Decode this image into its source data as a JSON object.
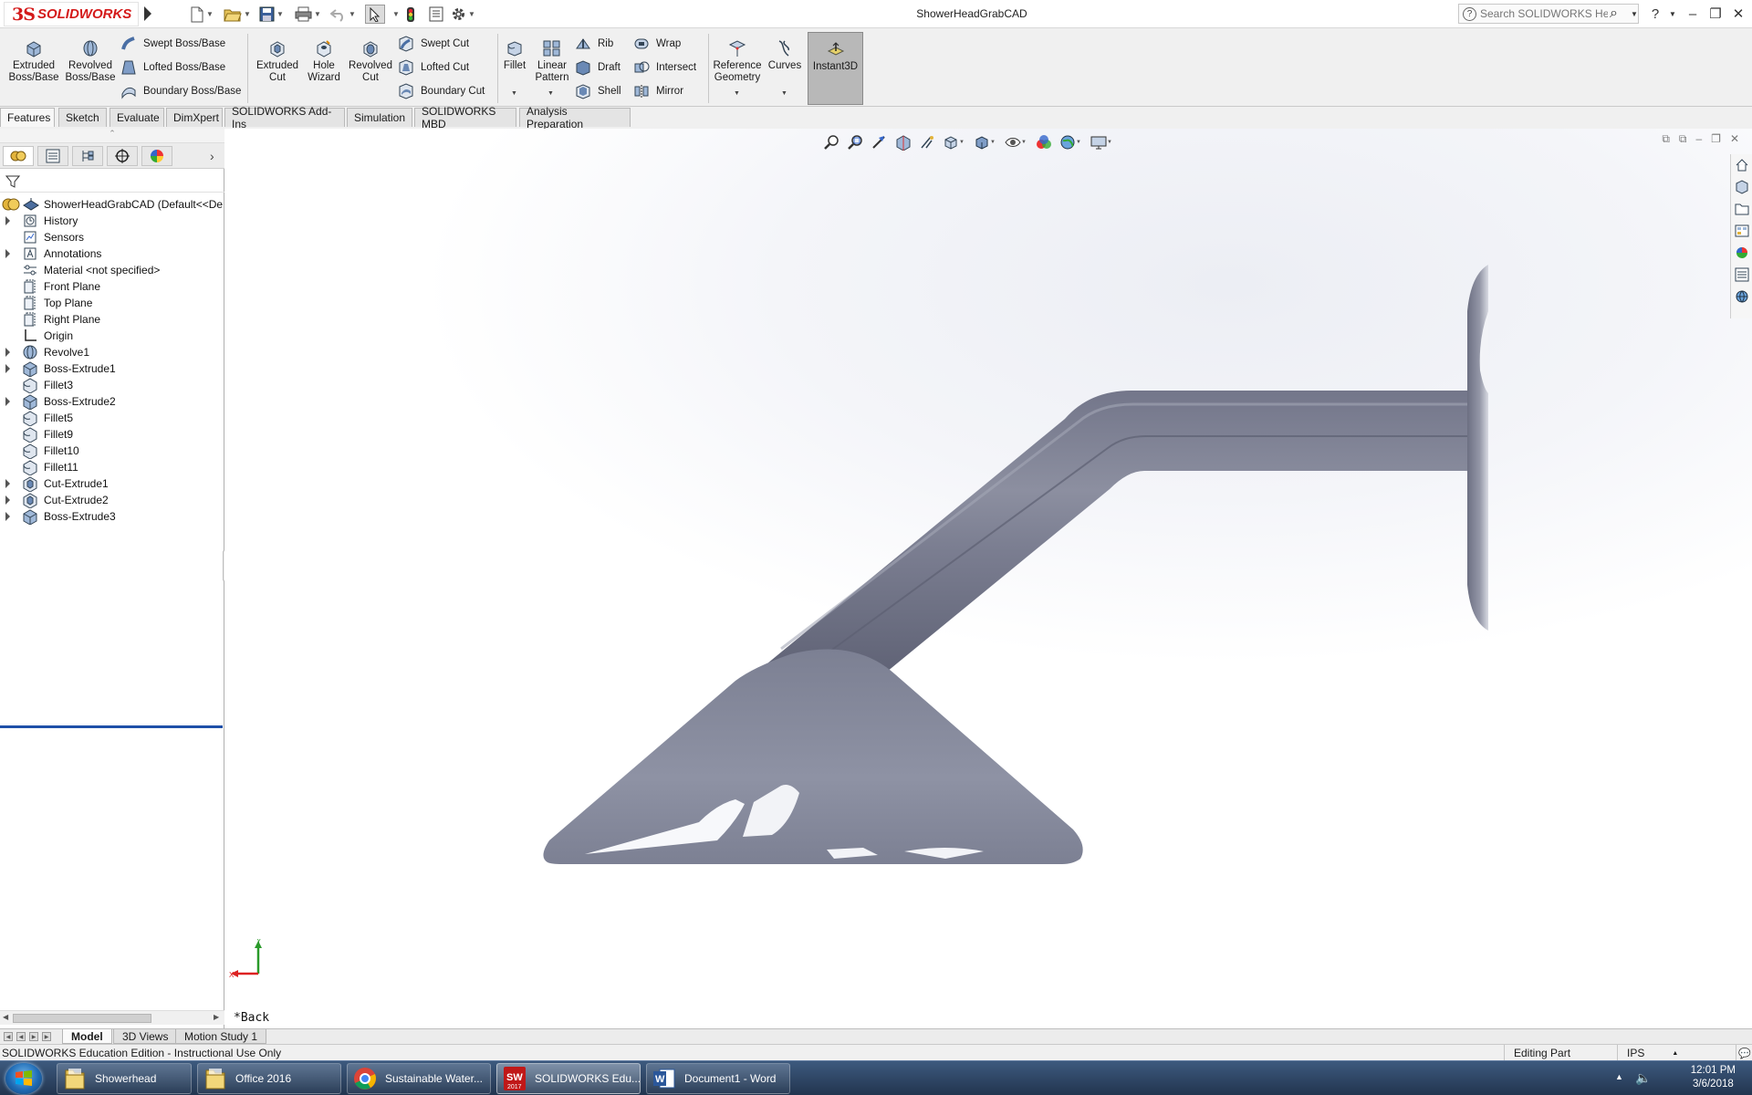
{
  "app": {
    "brand_ds": "3S",
    "brand_name": "SOLIDWORKS",
    "document_title": "ShowerHeadGrabCAD",
    "help_search_placeholder": "Search SOLIDWORKS Help"
  },
  "ribbon": {
    "extruded_boss": "Extruded Boss/Base",
    "revolved_boss": "Revolved Boss/Base",
    "swept_boss": "Swept Boss/Base",
    "lofted_boss": "Lofted Boss/Base",
    "boundary_boss": "Boundary Boss/Base",
    "extruded_cut": "Extruded Cut",
    "hole_wizard": "Hole Wizard",
    "revolved_cut": "Revolved Cut",
    "swept_cut": "Swept Cut",
    "lofted_cut": "Lofted Cut",
    "boundary_cut": "Boundary Cut",
    "fillet": "Fillet",
    "linear_pattern": "Linear Pattern",
    "rib": "Rib",
    "draft": "Draft",
    "shell": "Shell",
    "wrap": "Wrap",
    "intersect": "Intersect",
    "mirror": "Mirror",
    "reference_geometry": "Reference Geometry",
    "curves": "Curves",
    "instant3d": "Instant3D"
  },
  "tabs": [
    "Features",
    "Sketch",
    "Evaluate",
    "DimXpert",
    "SOLIDWORKS Add-Ins",
    "Simulation",
    "SOLIDWORKS MBD",
    "Analysis Preparation"
  ],
  "tree": {
    "root": "ShowerHeadGrabCAD  (Default<<De",
    "items": [
      {
        "label": "History",
        "icon": "history-icon",
        "exp": true
      },
      {
        "label": "Sensors",
        "icon": "sensors-icon",
        "exp": false
      },
      {
        "label": "Annotations",
        "icon": "annotations-icon",
        "exp": true
      },
      {
        "label": "Material <not specified>",
        "icon": "material-icon",
        "exp": false
      },
      {
        "label": "Front Plane",
        "icon": "plane-icon",
        "exp": false
      },
      {
        "label": "Top Plane",
        "icon": "plane-icon",
        "exp": false
      },
      {
        "label": "Right Plane",
        "icon": "plane-icon",
        "exp": false
      },
      {
        "label": "Origin",
        "icon": "origin-icon",
        "exp": false
      },
      {
        "label": "Revolve1",
        "icon": "revolve-icon",
        "exp": true
      },
      {
        "label": "Boss-Extrude1",
        "icon": "extrude-icon",
        "exp": true
      },
      {
        "label": "Fillet3",
        "icon": "fillet-icon",
        "exp": false
      },
      {
        "label": "Boss-Extrude2",
        "icon": "extrude-icon",
        "exp": true
      },
      {
        "label": "Fillet5",
        "icon": "fillet-icon",
        "exp": false
      },
      {
        "label": "Fillet9",
        "icon": "fillet-icon",
        "exp": false
      },
      {
        "label": "Fillet10",
        "icon": "fillet-icon",
        "exp": false
      },
      {
        "label": "Fillet11",
        "icon": "fillet-icon",
        "exp": false
      },
      {
        "label": "Cut-Extrude1",
        "icon": "cut-icon",
        "exp": true
      },
      {
        "label": "Cut-Extrude2",
        "icon": "cut-icon",
        "exp": true
      },
      {
        "label": "Boss-Extrude3",
        "icon": "extrude-icon",
        "exp": true
      }
    ]
  },
  "viewport": {
    "view_label": "*Back",
    "triad_x": "X",
    "triad_y": "Y",
    "model_color": "#8b8e9c"
  },
  "bottom_tabs": [
    "Model",
    "3D Views",
    "Motion Study 1"
  ],
  "status": {
    "message": "SOLIDWORKS Education Edition - Instructional Use Only",
    "mode": "Editing Part",
    "units": "IPS"
  },
  "taskbar": {
    "items": [
      {
        "label": "Showerhead",
        "icon": "folder-icon"
      },
      {
        "label": "Office 2016",
        "icon": "folder-icon"
      },
      {
        "label": "Sustainable Water...",
        "icon": "chrome-icon"
      },
      {
        "label": "SOLIDWORKS Edu...",
        "icon": "solidworks-icon"
      },
      {
        "label": "Document1 - Word",
        "icon": "word-icon"
      }
    ],
    "time": "12:01 PM",
    "date": "3/6/2018"
  }
}
